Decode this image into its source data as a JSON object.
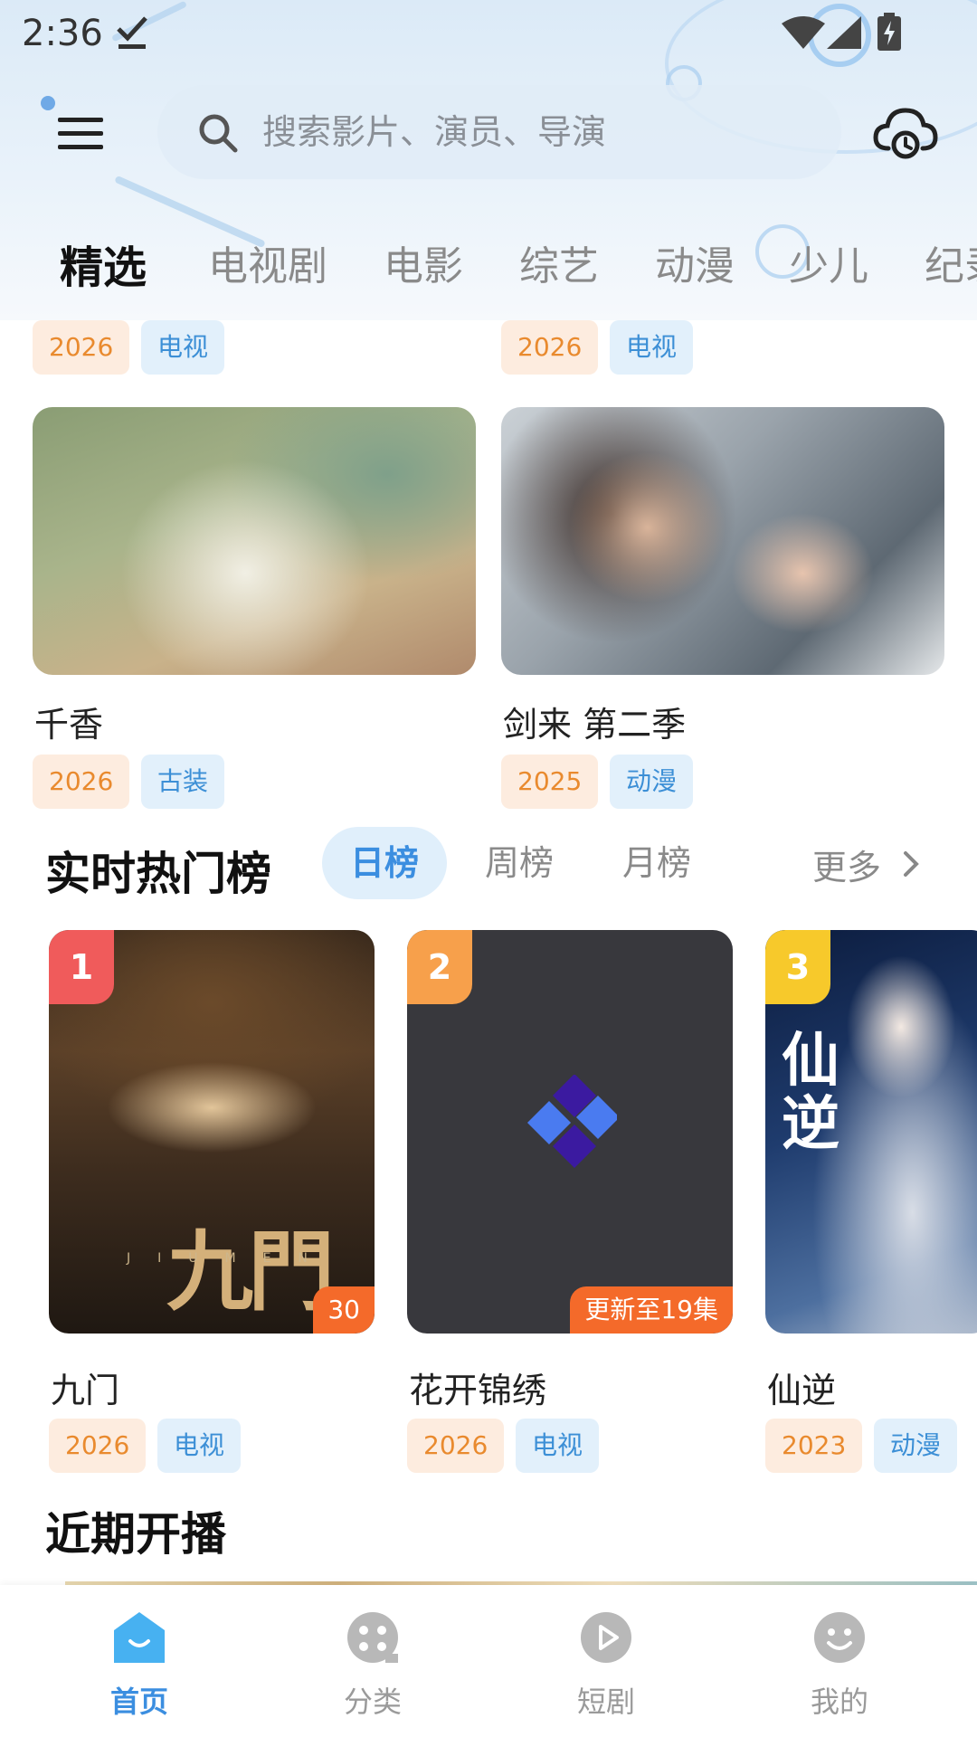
{
  "status_bar": {
    "time": "2:36"
  },
  "search": {
    "placeholder": "搜索影片、演员、导演"
  },
  "tabs": [
    "精选",
    "电视剧",
    "电影",
    "综艺",
    "动漫",
    "少儿",
    "纪录"
  ],
  "top_partial_cards": [
    {
      "year": "2026",
      "type": "电视"
    },
    {
      "year": "2026",
      "type": "电视"
    }
  ],
  "featured_cards": [
    {
      "title": "千香",
      "year": "2026",
      "type": "古装"
    },
    {
      "title": "剑来 第二季",
      "year": "2025",
      "type": "动漫"
    }
  ],
  "hot_rank": {
    "title": "实时热门榜",
    "tabs": [
      "日榜",
      "周榜",
      "月榜"
    ],
    "more": "更多",
    "items": [
      {
        "rank": "1",
        "title": "九门",
        "year": "2026",
        "type": "电视",
        "badge": "30",
        "poster_text": "九門",
        "poster_subtext": "JIUMEN"
      },
      {
        "rank": "2",
        "title": "花开锦绣",
        "year": "2026",
        "type": "电视",
        "badge": "更新至19集"
      },
      {
        "rank": "3",
        "title": "仙逆",
        "year": "2023",
        "type": "动漫",
        "poster_text": "仙逆"
      }
    ]
  },
  "upcoming": {
    "title": "近期开播"
  },
  "bottom_nav": [
    {
      "label": "首页"
    },
    {
      "label": "分类"
    },
    {
      "label": "短剧"
    },
    {
      "label": "我的"
    }
  ],
  "colors": {
    "accent": "#3b8ee0",
    "year_tag_bg": "#fdecdf",
    "year_tag_text": "#e98a2e",
    "type_tag_bg": "#e2f0fb",
    "type_tag_text": "#3c8fd6",
    "rank1": "#f05b5b",
    "rank2": "#f7a04b",
    "rank3": "#f7c92b",
    "episode_badge": "#f46a2a"
  },
  "icons": [
    "check-icon",
    "wifi-icon",
    "signal-icon",
    "battery-icon",
    "menu-icon",
    "search-icon",
    "cloud-icon",
    "chevron-right-icon",
    "home-icon",
    "category-icon",
    "play-icon",
    "smile-icon"
  ]
}
